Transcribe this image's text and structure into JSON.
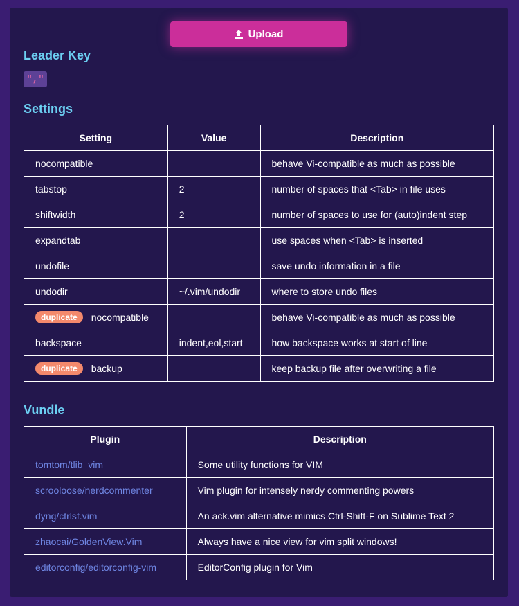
{
  "upload": {
    "label": "Upload",
    "icon": "upload-icon"
  },
  "leader": {
    "title": "Leader Key",
    "value": "\",\""
  },
  "settings": {
    "title": "Settings",
    "headers": [
      "Setting",
      "Value",
      "Description"
    ],
    "rows": [
      {
        "setting": "nocompatible",
        "value": "",
        "description": "behave Vi-compatible as much as possible",
        "badge": ""
      },
      {
        "setting": "tabstop",
        "value": "2",
        "description": "number of spaces that <Tab> in file uses",
        "badge": ""
      },
      {
        "setting": "shiftwidth",
        "value": "2",
        "description": "number of spaces to use for (auto)indent step",
        "badge": ""
      },
      {
        "setting": "expandtab",
        "value": "",
        "description": "use spaces when <Tab> is inserted",
        "badge": ""
      },
      {
        "setting": "undofile",
        "value": "",
        "description": "save undo information in a file",
        "badge": ""
      },
      {
        "setting": "undodir",
        "value": "~/.vim/undodir",
        "description": "where to store undo files",
        "badge": ""
      },
      {
        "setting": "nocompatible",
        "value": "",
        "description": "behave Vi-compatible as much as possible",
        "badge": "duplicate"
      },
      {
        "setting": "backspace",
        "value": "indent,eol,start",
        "description": "how backspace works at start of line",
        "badge": ""
      },
      {
        "setting": "backup",
        "value": "",
        "description": "keep backup file after overwriting a file",
        "badge": "duplicate"
      }
    ]
  },
  "vundle": {
    "title": "Vundle",
    "headers": [
      "Plugin",
      "Description"
    ],
    "rows": [
      {
        "plugin": "tomtom/tlib_vim",
        "description": "Some utility functions for VIM"
      },
      {
        "plugin": "scrooloose/nerdcommenter",
        "description": "Vim plugin for intensely nerdy commenting powers"
      },
      {
        "plugin": "dyng/ctrlsf.vim",
        "description": "An ack.vim alternative mimics Ctrl-Shift-F on Sublime Text 2"
      },
      {
        "plugin": "zhaocai/GoldenView.Vim",
        "description": "Always have a nice view for vim split windows!"
      },
      {
        "plugin": "editorconfig/editorconfig-vim",
        "description": "EditorConfig plugin for Vim"
      }
    ]
  },
  "colors": {
    "page_background": "#3a1d72",
    "panel_background": "#23174d",
    "section_title": "#6ccff2",
    "upload_button": "#cb2e9a",
    "badge": "#f4896c",
    "link": "#6f86e3",
    "leader_chip_bg": "#5d4196",
    "leader_chip_text": "#f06aa8"
  }
}
